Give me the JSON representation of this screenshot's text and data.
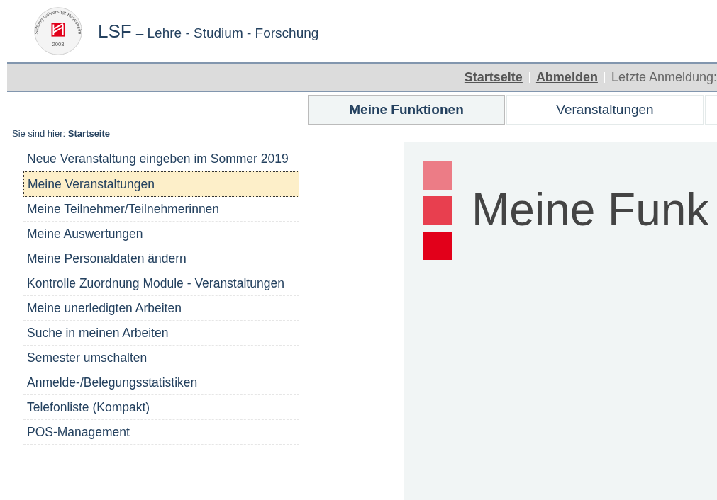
{
  "logo": {
    "ring_text": "Stiftung Universität Hildesheim",
    "year": "2003"
  },
  "site_title": {
    "main": "LSF",
    "subtitle": "– Lehre - Studium - Forschung"
  },
  "top_bar": {
    "links": [
      "Startseite",
      "Abmelden"
    ],
    "info": "Letzte Anmeldung:"
  },
  "tabs": [
    {
      "label": "Meine Funktionen",
      "selected": true
    },
    {
      "label": "Veranstaltungen",
      "selected": false
    },
    {
      "selected": false
    }
  ],
  "breadcrumb": {
    "prefix": "Sie sind hier:",
    "current": "Startseite"
  },
  "menu": [
    {
      "label": "Neue Veranstaltung eingeben im Sommer 2019",
      "selected": false
    },
    {
      "label": "Meine Veranstaltungen",
      "selected": true
    },
    {
      "label": "Meine Teilnehmer/Teilnehmerinnen",
      "selected": false
    },
    {
      "label": "Meine Auswertungen",
      "selected": false
    },
    {
      "label": "Meine Personaldaten ändern",
      "selected": false
    },
    {
      "label": "Kontrolle Zuordnung Module - Veranstaltungen",
      "selected": false
    },
    {
      "label": "Meine unerledigten Arbeiten",
      "selected": false
    },
    {
      "label": "Suche in meinen Arbeiten",
      "selected": false
    },
    {
      "label": "Semester umschalten",
      "selected": false
    },
    {
      "label": "Anmelde-/Belegungsstatistiken",
      "selected": false
    },
    {
      "label": "Telefonliste (Kompakt)",
      "selected": false
    },
    {
      "label": "POS-Management",
      "selected": false
    }
  ],
  "content": {
    "heading": "Meine Funk"
  }
}
